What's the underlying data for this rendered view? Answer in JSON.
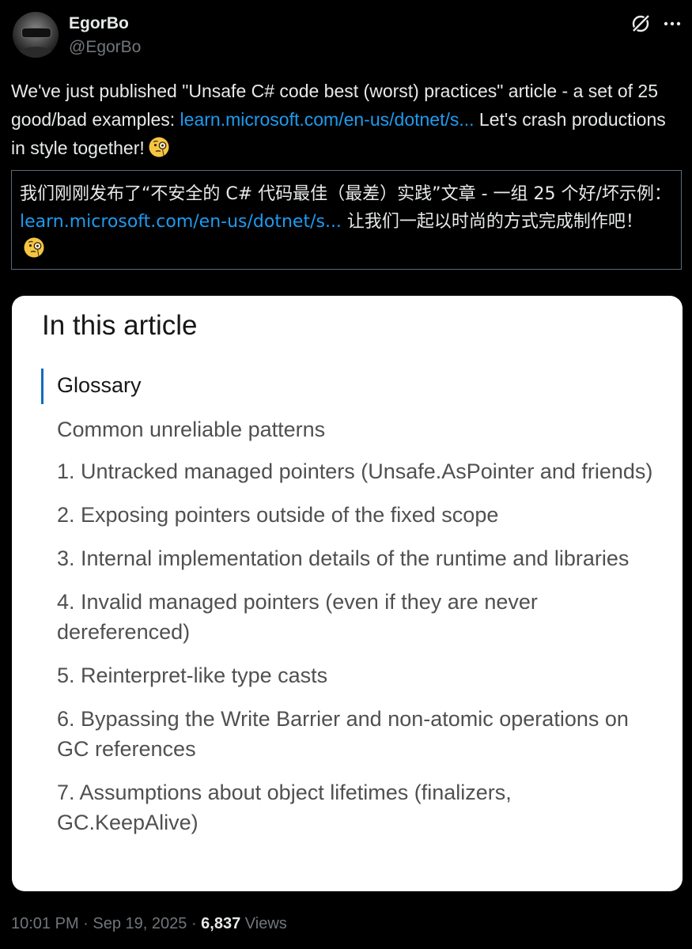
{
  "author": {
    "display_name": "EgorBo",
    "handle": "@EgorBo"
  },
  "header_icons": [
    "grok-icon",
    "more-icon"
  ],
  "tweet": {
    "text_part1": "We've just published \"Unsafe C# code best (worst) practices\" article - a set of 25 good/bad examples: ",
    "link_text": "learn.microsoft.com/en-us/dotnet/s...",
    "text_part2": " Let's crash productions in style together!",
    "emoji": "face-with-monocle-emoji"
  },
  "translation": {
    "text_part1": "我们刚刚发布了“不安全的 C# 代码最佳（最差）实践”文章 - 一组 25 个好/坏示例： ",
    "link_text": "learn.microsoft.com/en-us/dotnet/s...",
    "text_part2": " 让我们一起以时尚的方式完成制作吧！ ",
    "emoji": "face-with-monocle-emoji"
  },
  "card": {
    "heading": "In this article",
    "current_item": "Glossary",
    "items": [
      "Common unreliable patterns",
      "1. Untracked managed pointers (Unsafe.AsPointer and friends)",
      "2. Exposing pointers outside of the fixed scope",
      "3. Internal implementation details of the runtime and libraries",
      "4. Invalid managed pointers (even if they are never dereferenced)",
      "5. Reinterpret-like type casts",
      "6. Bypassing the Write Barrier and non-atomic operations on GC references",
      "7. Assumptions about object lifetimes (finalizers, GC.KeepAlive)"
    ]
  },
  "footer": {
    "time": "10:01 PM",
    "separator": " · ",
    "date": "Sep 19, 2025",
    "views_count": "6,837",
    "views_label": "Views"
  },
  "colors": {
    "background": "#000000",
    "text": "#e7e9ea",
    "muted": "#71767b",
    "link": "#1d9bf0",
    "card_background": "#ffffff",
    "toc_indicator": "#0f6cbd"
  }
}
